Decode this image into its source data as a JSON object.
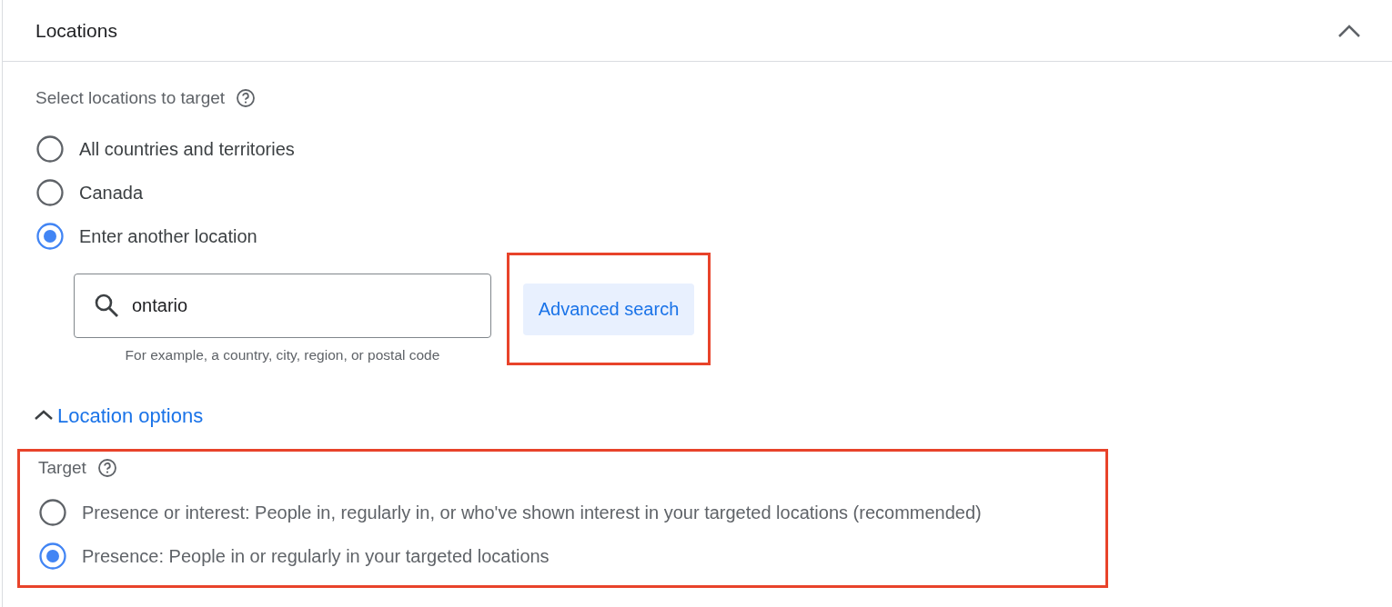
{
  "panel": {
    "title": "Locations",
    "expanded": true
  },
  "locations": {
    "label": "Select locations to target",
    "options": [
      {
        "label": "All countries and territories",
        "selected": false
      },
      {
        "label": "Canada",
        "selected": false
      },
      {
        "label": "Enter another location",
        "selected": true
      }
    ]
  },
  "search": {
    "value": "ontario",
    "hint": "For example, a country, city, region, or postal code"
  },
  "advanced_search": {
    "label": "Advanced search",
    "highlighted": true
  },
  "location_options": {
    "label": "Location options",
    "expanded": true
  },
  "target": {
    "label": "Target",
    "highlighted": true,
    "options": [
      {
        "label": "Presence or interest: People in, regularly in, or who've shown interest in your targeted locations (recommended)",
        "selected": false
      },
      {
        "label": "Presence: People in or regularly in your targeted locations",
        "selected": true
      }
    ]
  }
}
